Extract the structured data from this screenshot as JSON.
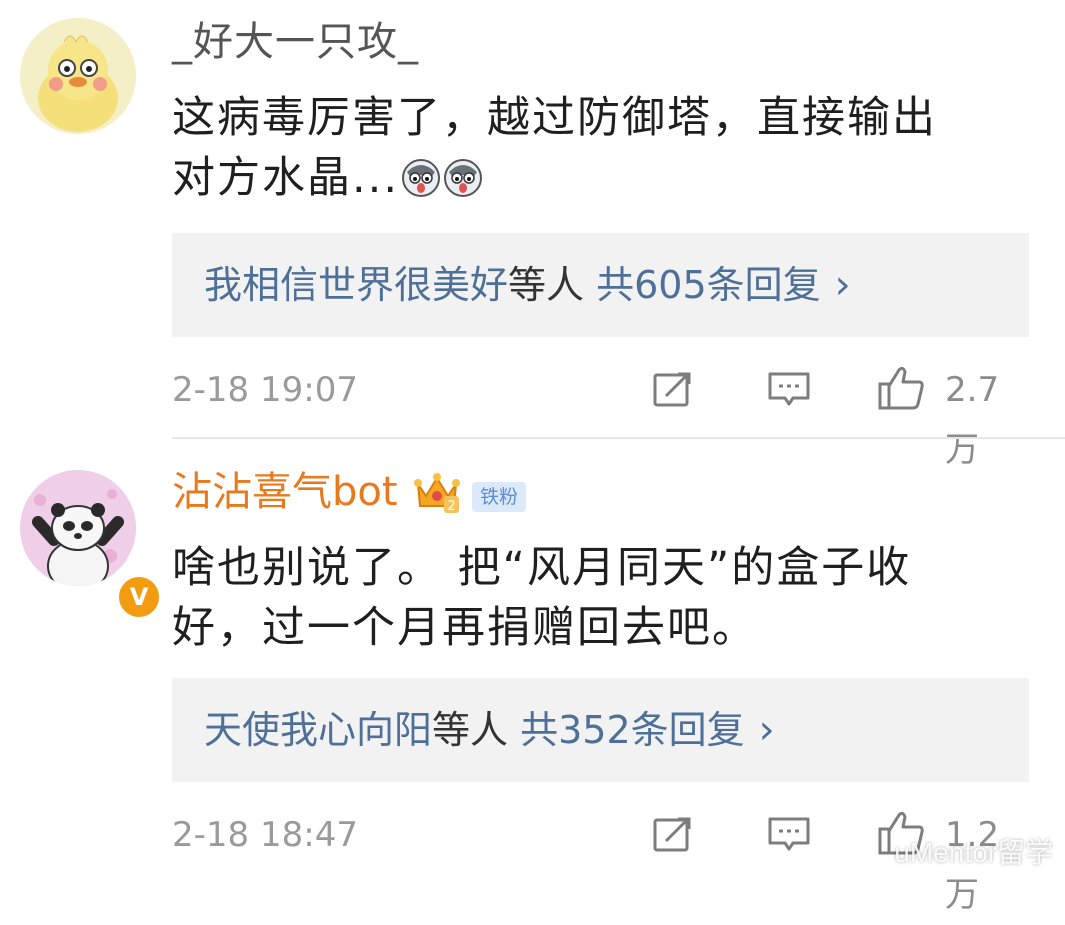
{
  "comments": [
    {
      "username": "_好大一只攻_",
      "text_lines": [
        "这病毒厉害了，越过防御塔，直接输出",
        "对方水晶..."
      ],
      "emoji_icons": [
        "husky-doge-emoji-icon",
        "husky-doge-emoji-icon"
      ],
      "reply_summary": {
        "names": "我相信世界很美好",
        "middle": "等人",
        "count_text": "共605条回复",
        "arrow": "›"
      },
      "timestamp": "2-18 19:07",
      "likes": "2.7万",
      "avatar_icon": "yellow-duck-avatar"
    },
    {
      "username": "沾沾喜气bot",
      "badges": {
        "fan_badge": "铁粉",
        "crown_icon": "crown-level-2-icon",
        "verified_icon": "v-verified-icon"
      },
      "text_lines": [
        "啥也别说了。 把“风月同天”的盒子收",
        "好，过一个月再捐赠回去吧。"
      ],
      "reply_summary": {
        "names": "天使我心向阳",
        "middle": "等人",
        "count_text": "共352条回复",
        "arrow": "›"
      },
      "timestamp": "2-18 18:47",
      "likes": "1.2万",
      "avatar_icon": "panda-avatar"
    }
  ],
  "action_icons": [
    "repost-icon",
    "comment-icon",
    "like-icon"
  ],
  "watermark": "uMentor留学",
  "colors": {
    "username_vip": "#e8791c",
    "link": "#4e6f98",
    "meta": "#9a9a9a",
    "reply_bg": "#f2f2f2"
  }
}
